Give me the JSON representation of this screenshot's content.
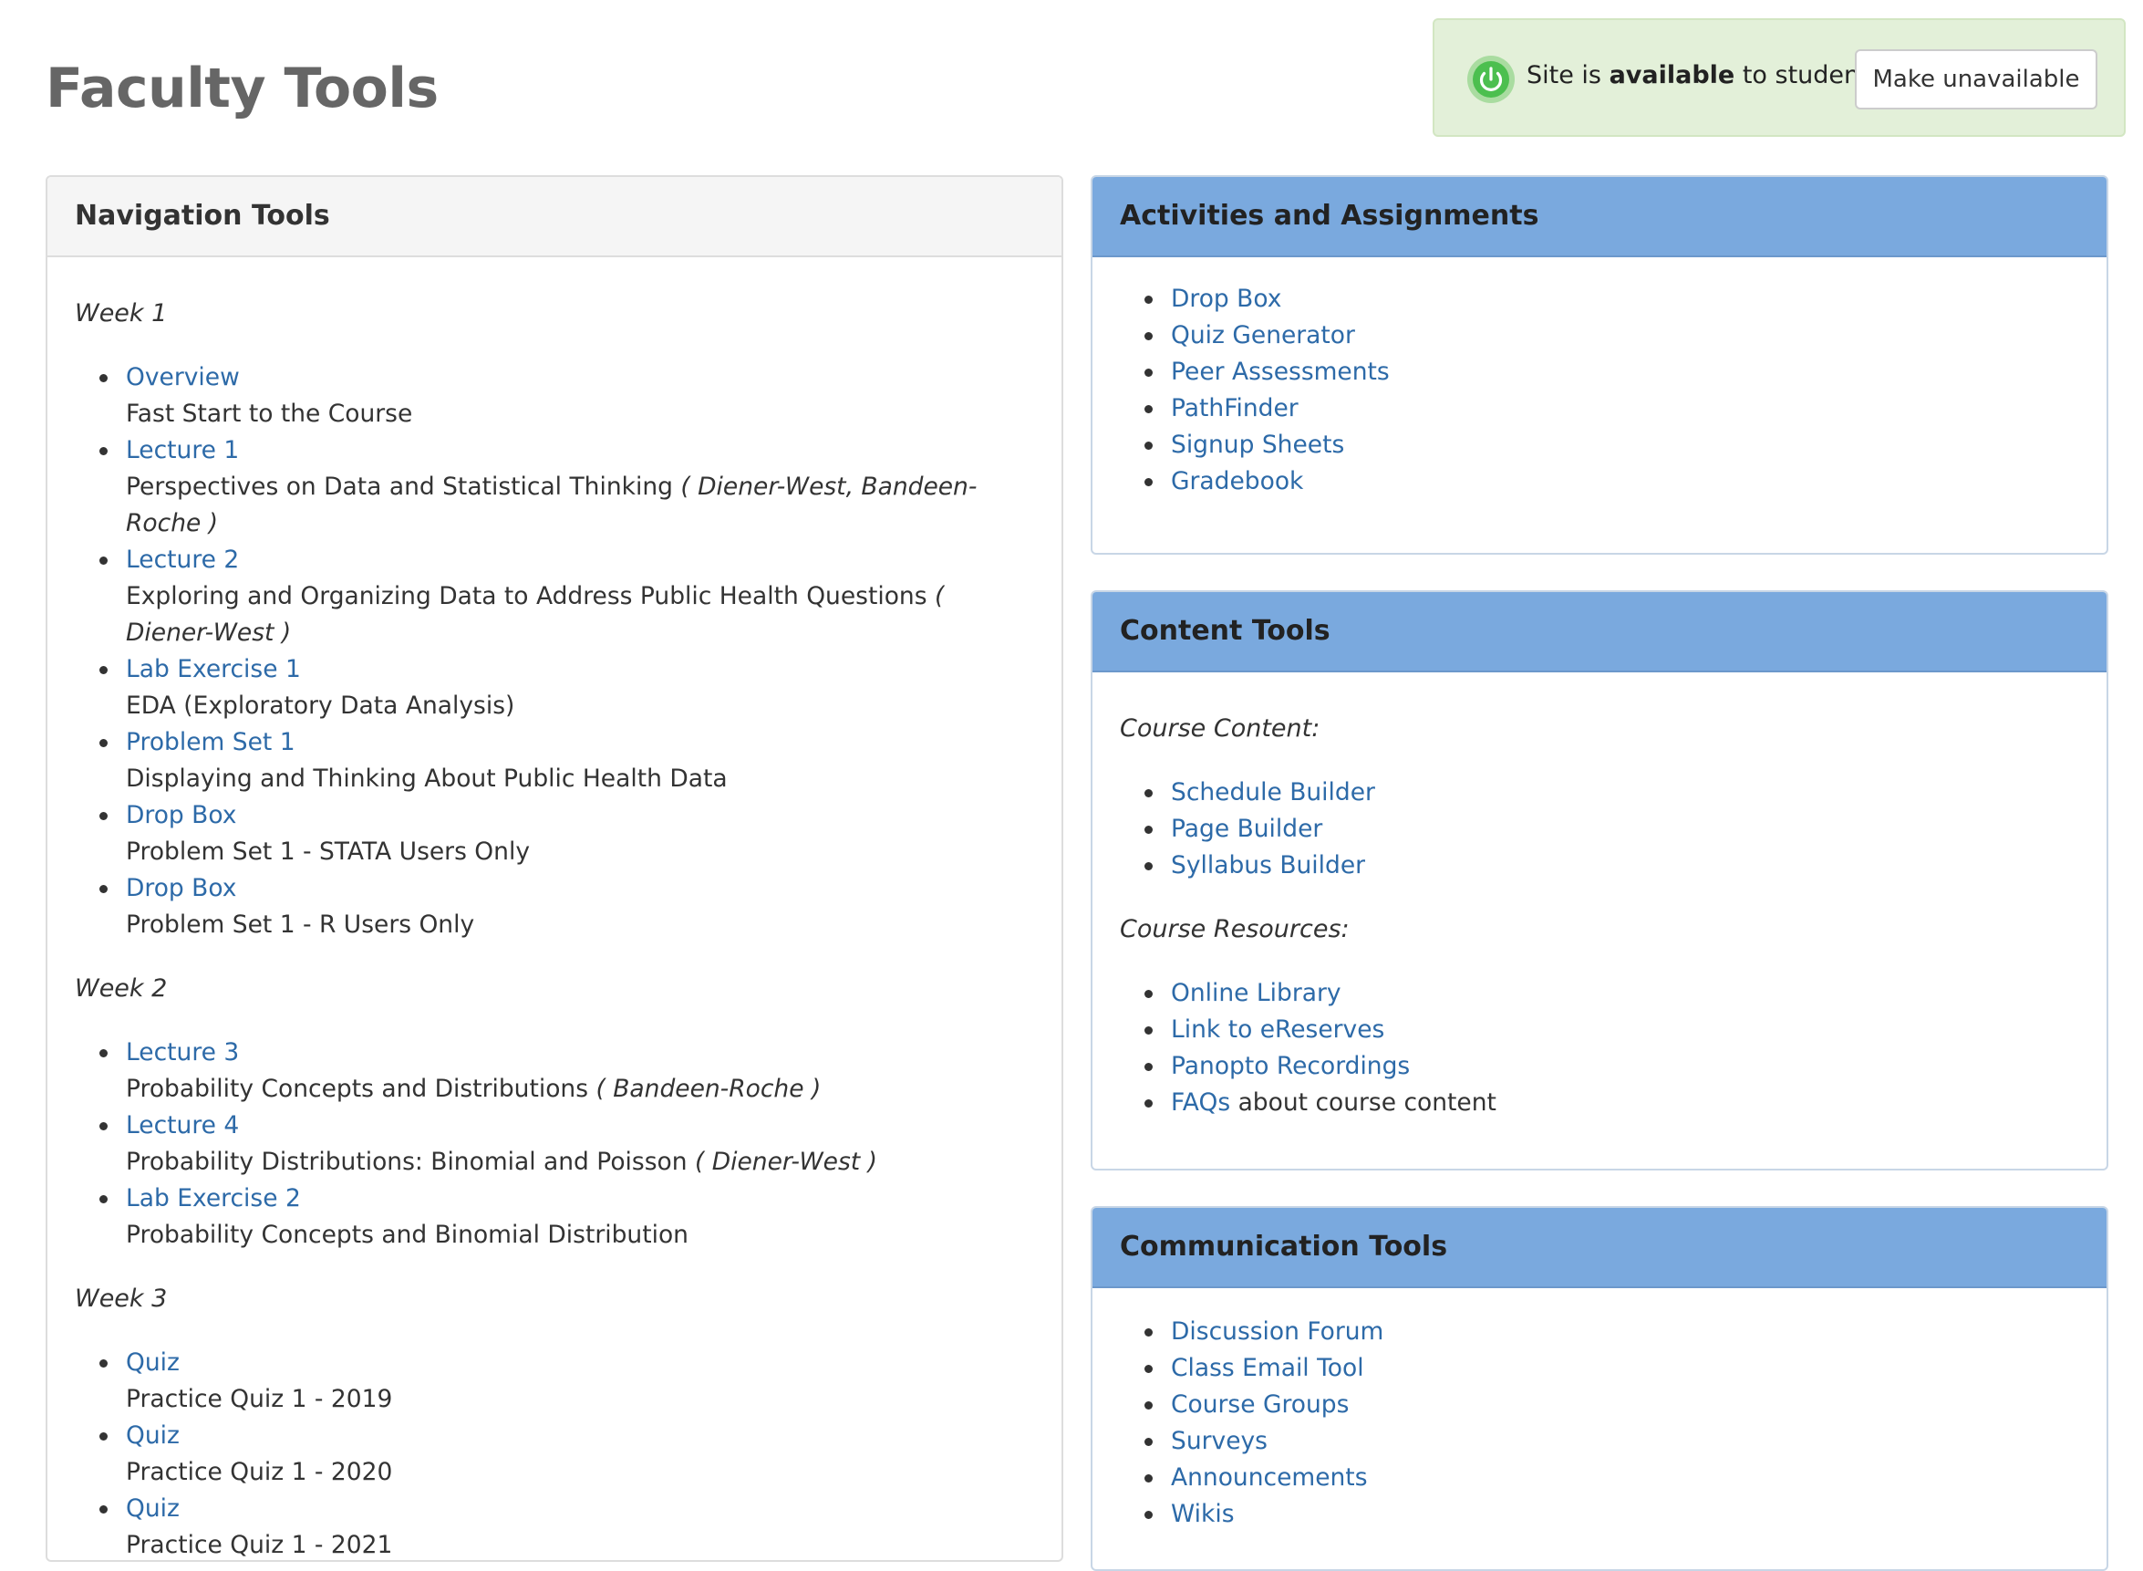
{
  "page": {
    "title": "Faculty Tools"
  },
  "availability": {
    "prefix": "Site is ",
    "status": "available",
    "suffix": " to students.",
    "button_label": "Make unavailable",
    "icon": "power-icon",
    "icon_color": "#4cbf4f"
  },
  "colors": {
    "link": "#2d6aa8",
    "panel_heading_blue": "#7aa9de",
    "availability_bg": "#e3f0d9"
  },
  "navigation": {
    "heading": "Navigation Tools",
    "weeks": [
      {
        "label": "Week 1",
        "items": [
          {
            "link": "Overview",
            "desc": "Fast Start to the Course",
            "authors": ""
          },
          {
            "link": "Lecture 1",
            "desc": "Perspectives on Data and Statistical Thinking",
            "authors": "( Diener-West, Bandeen-Roche )"
          },
          {
            "link": "Lecture 2",
            "desc": "Exploring and Organizing Data to Address Public Health Questions",
            "authors": "( Diener-West )"
          },
          {
            "link": "Lab Exercise 1",
            "desc": "EDA (Exploratory Data Analysis)",
            "authors": ""
          },
          {
            "link": "Problem Set 1",
            "desc": "Displaying and Thinking About Public Health Data",
            "authors": ""
          },
          {
            "link": "Drop Box",
            "desc": "Problem Set 1 - STATA Users Only",
            "authors": ""
          },
          {
            "link": "Drop Box",
            "desc": "Problem Set 1 - R Users Only",
            "authors": ""
          }
        ]
      },
      {
        "label": "Week 2",
        "items": [
          {
            "link": "Lecture 3",
            "desc": "Probability Concepts and Distributions",
            "authors": "( Bandeen-Roche )"
          },
          {
            "link": "Lecture 4",
            "desc": "Probability Distributions: Binomial and Poisson",
            "authors": "( Diener-West )"
          },
          {
            "link": "Lab Exercise 2",
            "desc": "Probability Concepts and Binomial Distribution",
            "authors": ""
          }
        ]
      },
      {
        "label": "Week 3",
        "items": [
          {
            "link": "Quiz",
            "desc": "Practice Quiz 1 - 2019",
            "authors": ""
          },
          {
            "link": "Quiz",
            "desc": "Practice Quiz 1 - 2020",
            "authors": ""
          },
          {
            "link": "Quiz",
            "desc": "Practice Quiz 1 - 2021",
            "authors": ""
          }
        ]
      }
    ]
  },
  "activities": {
    "heading": "Activities and Assignments",
    "items": [
      "Drop Box",
      "Quiz Generator",
      "Peer Assessments",
      "PathFinder",
      "Signup Sheets",
      "Gradebook"
    ]
  },
  "content_tools": {
    "heading": "Content Tools",
    "course_content_label": "Course Content:",
    "course_content": [
      "Schedule Builder",
      "Page Builder",
      "Syllabus Builder"
    ],
    "course_resources_label": "Course Resources:",
    "course_resources": [
      "Online Library",
      "Link to eReserves",
      "Panopto Recordings"
    ],
    "faq": {
      "link": "FAQs",
      "text": " about course content"
    }
  },
  "communication": {
    "heading": "Communication Tools",
    "items": [
      "Discussion Forum",
      "Class Email Tool",
      "Course Groups",
      "Surveys",
      "Announcements",
      "Wikis"
    ]
  }
}
